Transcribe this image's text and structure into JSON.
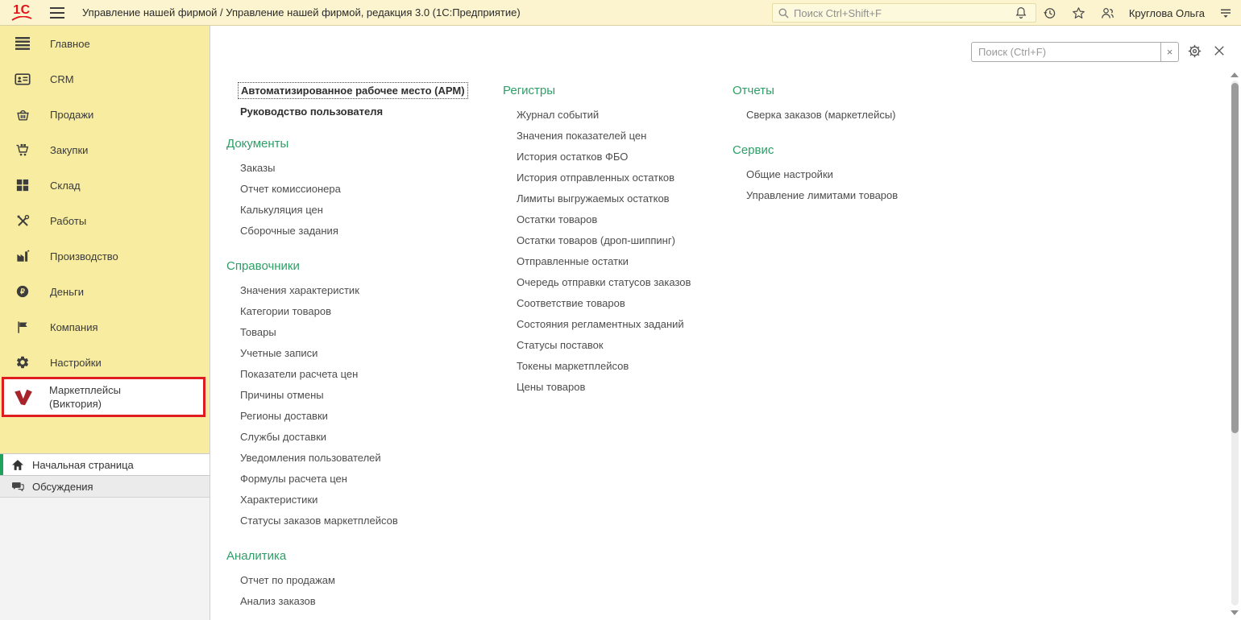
{
  "topbar": {
    "logo_text": "1С",
    "title": "Управление нашей фирмой / Управление нашей фирмой, редакция 3.0  (1С:Предприятие)",
    "search_placeholder": "Поиск Ctrl+Shift+F",
    "user_name": "Круглова Ольга",
    "icons": [
      "search-icon",
      "bell-icon",
      "history-icon",
      "star-icon",
      "users-icon",
      "user-menu-icon"
    ]
  },
  "sidebar": {
    "items": [
      "Главное",
      "CRM",
      "Продажи",
      "Закупки",
      "Склад",
      "Работы",
      "Производство",
      "Деньги",
      "Компания",
      "Настройки"
    ],
    "item_icons": [
      "list-icon",
      "crm-card-icon",
      "basket-icon",
      "cart-icon",
      "warehouse-icon",
      "tools-icon",
      "factory-icon",
      "ruble-icon",
      "flag-icon",
      "gear-icon"
    ],
    "marketplace": {
      "line1": "Маркетплейсы",
      "line2": "(Виктория)",
      "icon": "marketplace-v-icon",
      "highlighted": true
    },
    "footer": [
      "Начальная страница",
      "Обсуждения"
    ],
    "footer_icons": [
      "home-icon",
      "discussions-icon"
    ]
  },
  "content": {
    "search_placeholder": "Поиск (Ctrl+F)",
    "clear_label": "×",
    "top_commands": [
      "Автоматизированное рабочее место (АРМ)",
      "Руководство пользователя"
    ],
    "columns": [
      {
        "sections": [
          {
            "title": "Документы",
            "items": [
              "Заказы",
              "Отчет комиссионера",
              "Калькуляция цен",
              "Сборочные задания"
            ]
          },
          {
            "title": "Справочники",
            "items": [
              "Значения характеристик",
              "Категории товаров",
              "Товары",
              "Учетные записи",
              "Показатели расчета цен",
              "Причины отмены",
              "Регионы доставки",
              "Службы доставки",
              "Уведомления пользователей",
              "Формулы расчета цен",
              "Характеристики",
              "Статусы заказов маркетплейсов"
            ]
          },
          {
            "title": "Аналитика",
            "items": [
              "Отчет по продажам",
              "Анализ заказов"
            ]
          }
        ]
      },
      {
        "sections": [
          {
            "title": "Регистры",
            "items": [
              "Журнал событий",
              "Значения показателей цен",
              "История остатков ФБО",
              "История отправленных остатков",
              "Лимиты выгружаемых остатков",
              "Остатки товаров",
              "Остатки товаров (дроп-шиппинг)",
              "Отправленные остатки",
              "Очередь отправки статусов заказов",
              "Соответствие товаров",
              "Состояния регламентных заданий",
              "Статусы поставок",
              "Токены маркетплейсов",
              "Цены товаров"
            ]
          }
        ]
      },
      {
        "sections": [
          {
            "title": "Отчеты",
            "items": [
              "Сверка заказов (маркетлейсы)"
            ]
          },
          {
            "title": "Сервис",
            "items": [
              "Общие настройки",
              "Управление лимитами товаров"
            ]
          }
        ]
      }
    ]
  },
  "colors": {
    "topbar_yellow": "#fbf4cf",
    "sidebar_yellow": "#f8eca1",
    "accent_green": "#2e9e67",
    "active_tab_green": "#1fa35c",
    "brand_red": "#e3121a",
    "highlight_border_red": "#df1d20"
  }
}
